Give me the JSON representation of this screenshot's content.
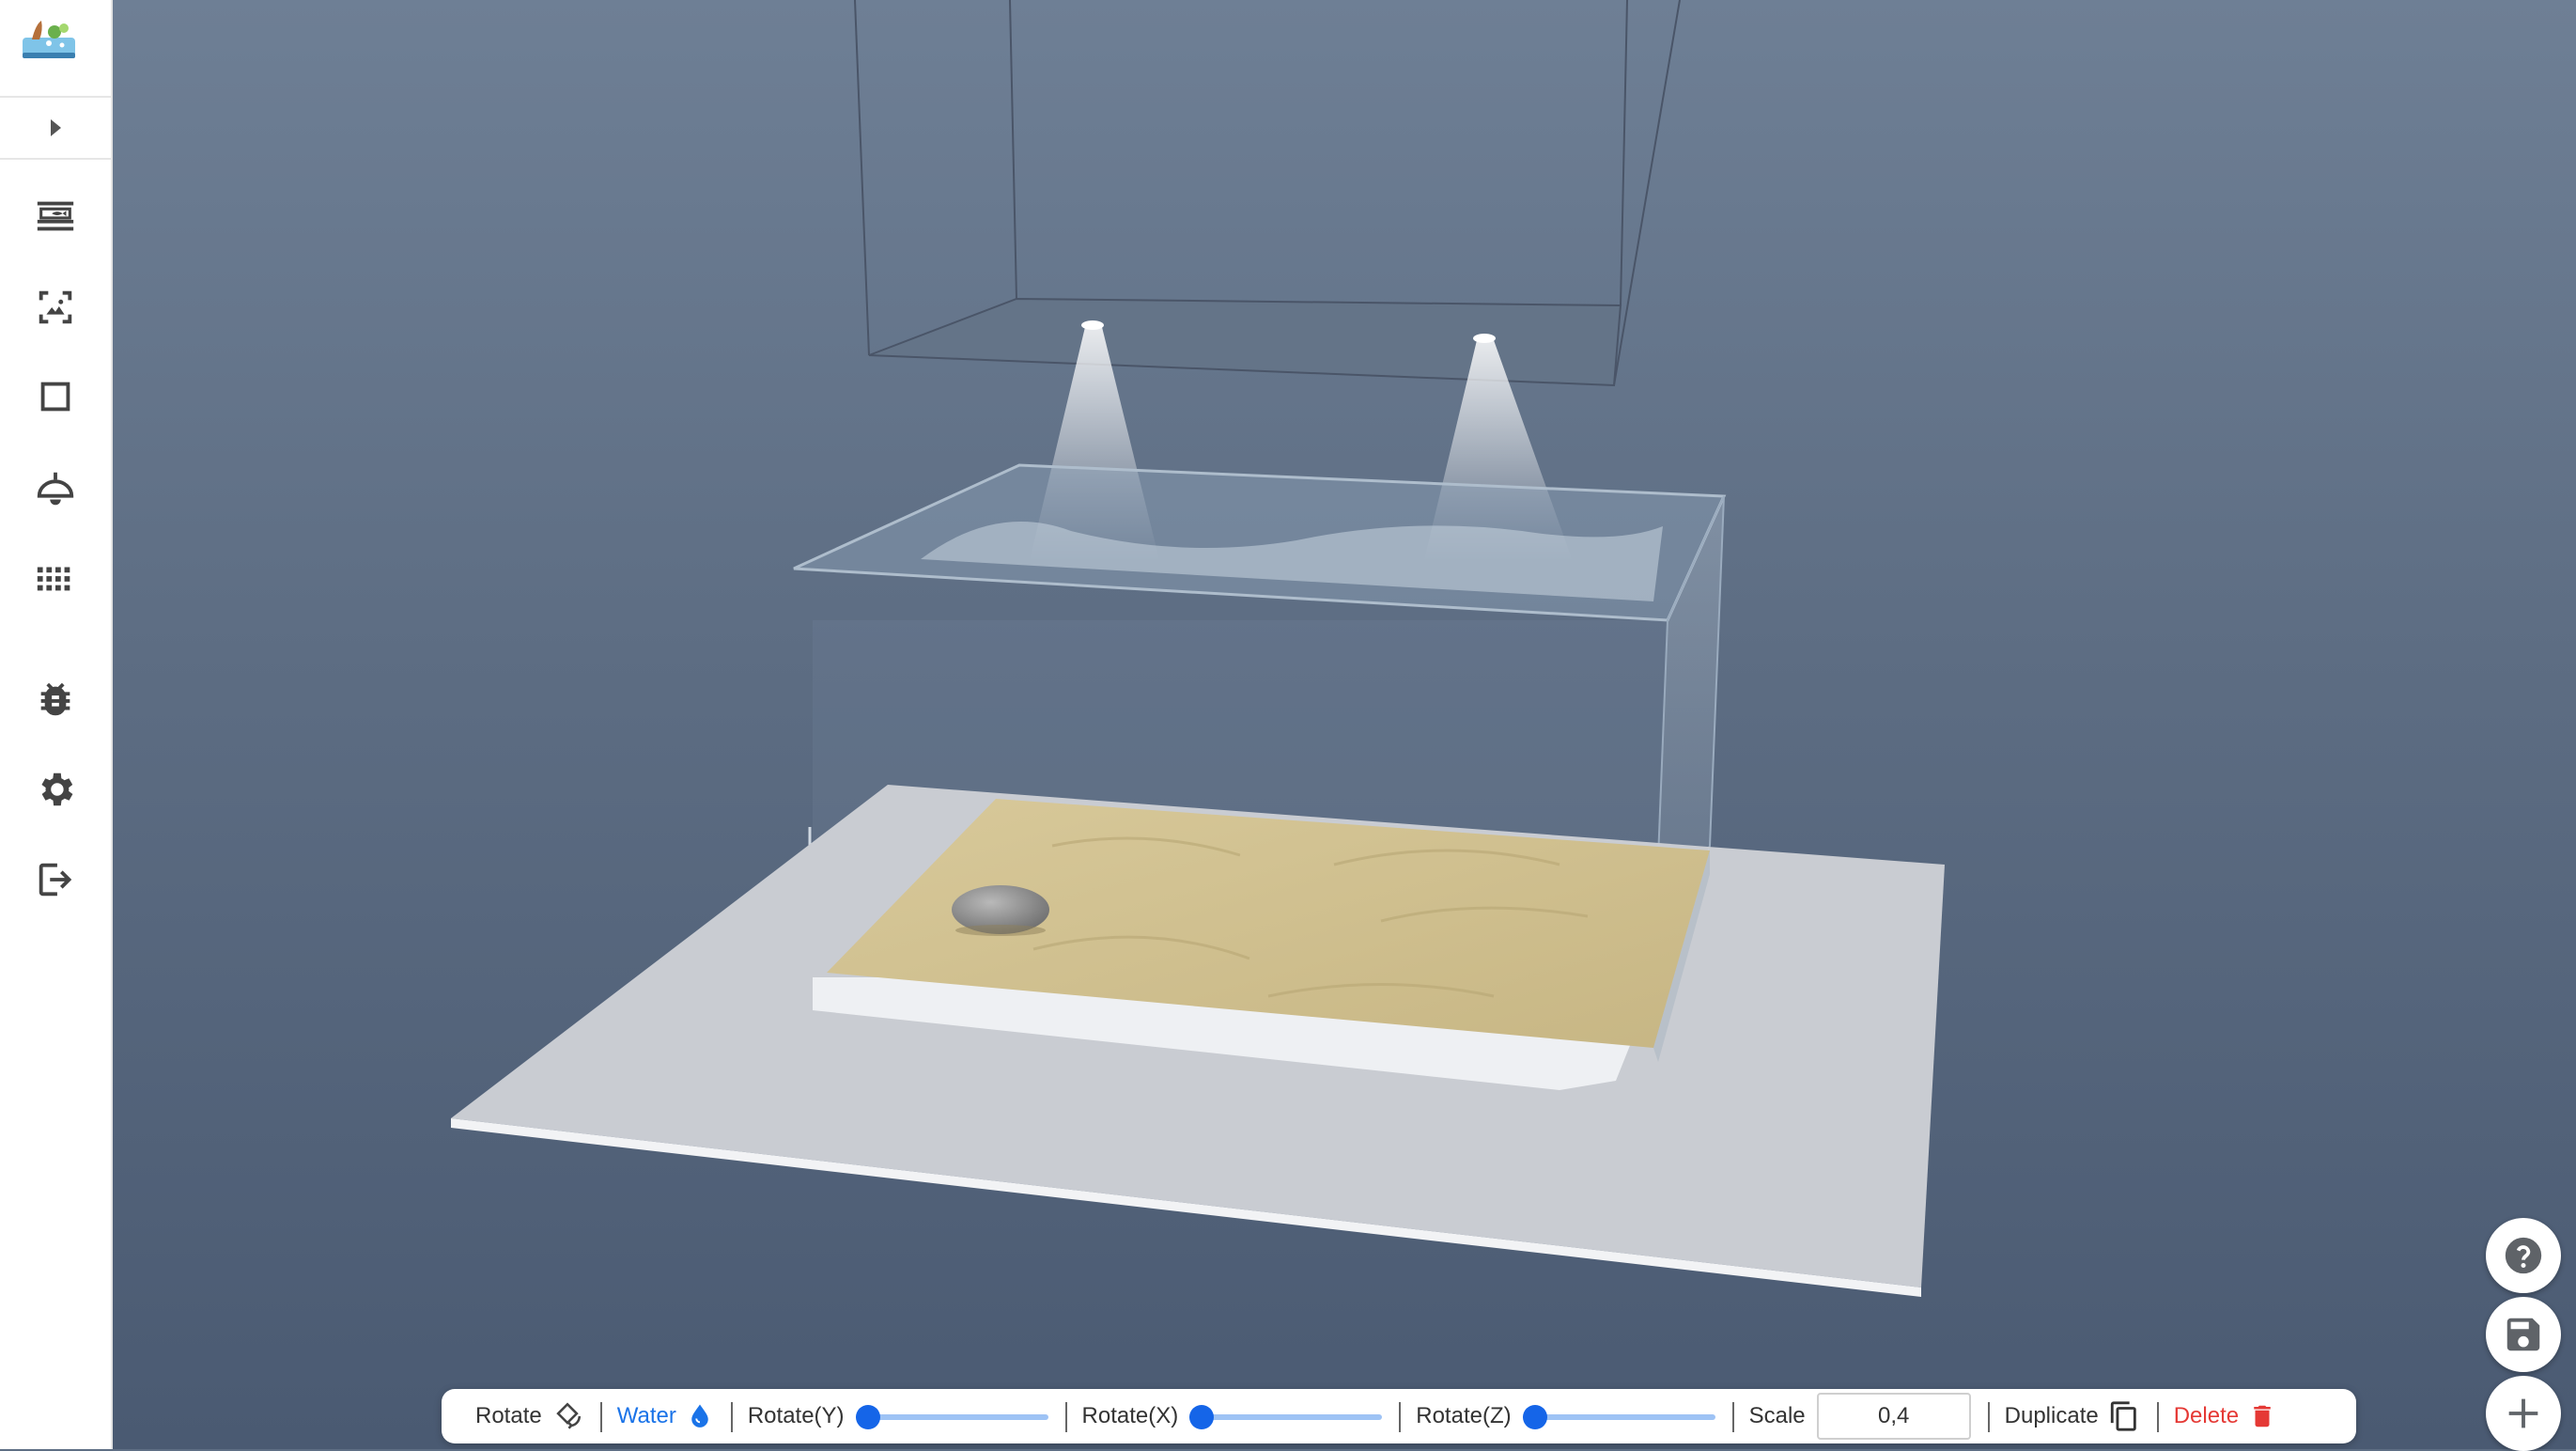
{
  "app": {
    "logo_icon": "aquarium-logo-icon"
  },
  "sidebar": {
    "expand_icon": "chevron-right-icon",
    "items": [
      {
        "name": "aquarium-icon"
      },
      {
        "name": "background-image-icon"
      },
      {
        "name": "square-shape-icon"
      },
      {
        "name": "lamp-icon"
      },
      {
        "name": "grid-dots-icon"
      },
      {
        "name": "bug-icon"
      },
      {
        "name": "settings-gear-icon"
      },
      {
        "name": "logout-icon"
      }
    ]
  },
  "toolbar": {
    "rotate_label": "Rotate",
    "water_label": "Water",
    "rotate_y_label": "Rotate(Y)",
    "rotate_y_value": 0,
    "rotate_x_label": "Rotate(X)",
    "rotate_x_value": 0,
    "rotate_z_label": "Rotate(Z)",
    "rotate_z_value": 0,
    "scale_label": "Scale",
    "scale_value": "0,4",
    "duplicate_label": "Duplicate",
    "delete_label": "Delete"
  },
  "colors": {
    "accent": "#1a73e8",
    "danger": "#e53935",
    "slider_thumb": "#1565e8",
    "slider_track": "#9ec3f5"
  },
  "fabs": [
    {
      "name": "help-icon"
    },
    {
      "name": "save-icon"
    },
    {
      "name": "add-icon"
    }
  ]
}
